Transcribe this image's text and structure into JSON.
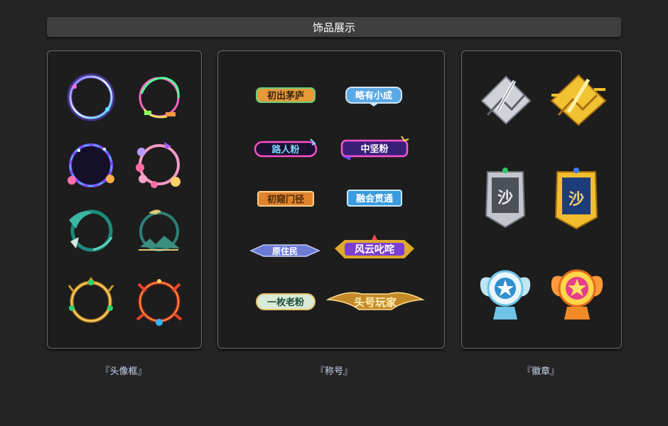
{
  "header": {
    "title": "饰品展示"
  },
  "sections": {
    "frames": {
      "caption": "『头像框』",
      "icons": [
        "neon-ring-frame-icon",
        "neon-vine-frame-icon",
        "galaxy-frame-icon",
        "flower-frame-icon",
        "jade-wave-frame-icon",
        "jade-landscape-frame-icon",
        "gold-gem-frame-icon",
        "red-flame-frame-icon"
      ]
    },
    "titles": {
      "caption": "『称号』",
      "items": [
        "初出茅庐",
        "略有小成",
        "路人粉",
        "中坚粉",
        "初窥门径",
        "融会贯通",
        "原住民",
        "风云叱咤",
        "一枚老粉",
        "头号玩家"
      ]
    },
    "badges": {
      "caption": "『徽章』",
      "sand_glyph": "沙"
    }
  },
  "colors": {
    "background": "#242424",
    "panel": "#1d1d1d",
    "header": "#3f3f3f",
    "caption": "#c9d8f0"
  }
}
